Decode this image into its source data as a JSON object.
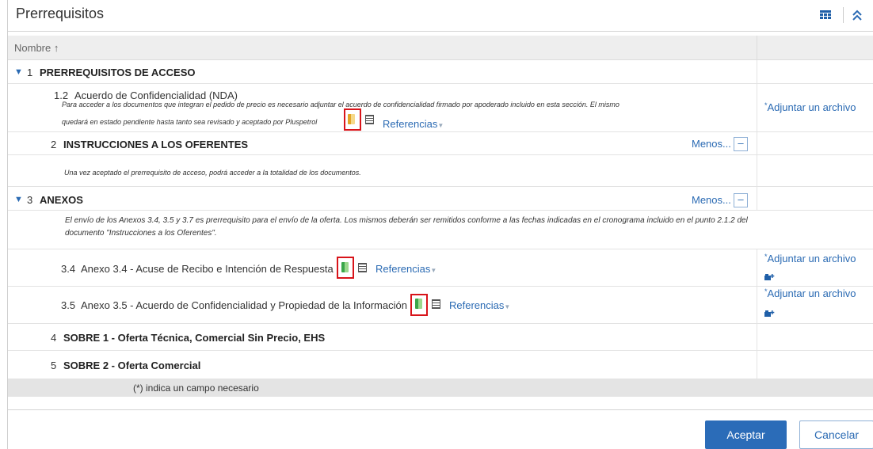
{
  "header": {
    "title": "Prerrequisitos",
    "grid_icon": "grid-icon",
    "collapse_icon": "double-chevron-up-icon"
  },
  "columns": {
    "name": "Nombre ↑"
  },
  "rows": {
    "r1": {
      "num": "1",
      "title": "PRERREQUISITOS DE ACCESO"
    },
    "r12": {
      "num": "1.2",
      "title": "Acuerdo de Confidencialidad (NDA)",
      "desc_line1": "Para acceder a los documentos que integran el pedido de precio es necesario adjuntar el acuerdo de confidencialidad firmado por apoderado incluido en esta sección. El mismo",
      "desc_line2": "quedará en estado pendiente hasta tanto sea revisado y aceptado por Pluspetrol",
      "references": "Referencias",
      "attach": "Adjuntar un archivo"
    },
    "r2": {
      "num": "2",
      "title": "INSTRUCCIONES A LOS OFERENTES",
      "menos": "Menos...",
      "menos_btn": "–",
      "desc": "Una vez aceptado el prerrequisito de acceso, podrá acceder a la totalidad de los documentos."
    },
    "r3": {
      "num": "3",
      "title": "ANEXOS",
      "menos": "Menos...",
      "menos_btn": "–",
      "desc_line1": "El envío de los Anexos 3.4, 3.5 y 3.7 es prerrequisito para el envío de la oferta. Los mismos deberán ser remitidos conforme a las fechas indicadas en el cronograma incluido en el punto 2.1.2 del",
      "desc_line2": "documento \"Instrucciones a los Oferentes\"."
    },
    "r34": {
      "num": "3.4",
      "title": "Anexo 3.4 - Acuse de Recibo e Intención de Respuesta",
      "references": "Referencias",
      "attach": "Adjuntar un archivo"
    },
    "r35": {
      "num": "3.5",
      "title": "Anexo 3.5 - Acuerdo de Confidencialidad y Propiedad de la Información",
      "references": "Referencias",
      "attach": "Adjuntar un archivo"
    },
    "r4": {
      "num": "4",
      "title": "SOBRE 1 - Oferta Técnica, Comercial Sin Precio, EHS"
    },
    "r5": {
      "num": "5",
      "title": "SOBRE 2 - Oferta Comercial"
    }
  },
  "required_note": "(*) indica un campo necesario",
  "required_star": "*",
  "buttons": {
    "accept": "Aceptar",
    "cancel": "Cancelar"
  },
  "colors": {
    "accent": "#2b6cb8",
    "highlight_box": "#d8141a",
    "doc_orange": "#e3a526",
    "doc_green": "#3aa64a"
  }
}
